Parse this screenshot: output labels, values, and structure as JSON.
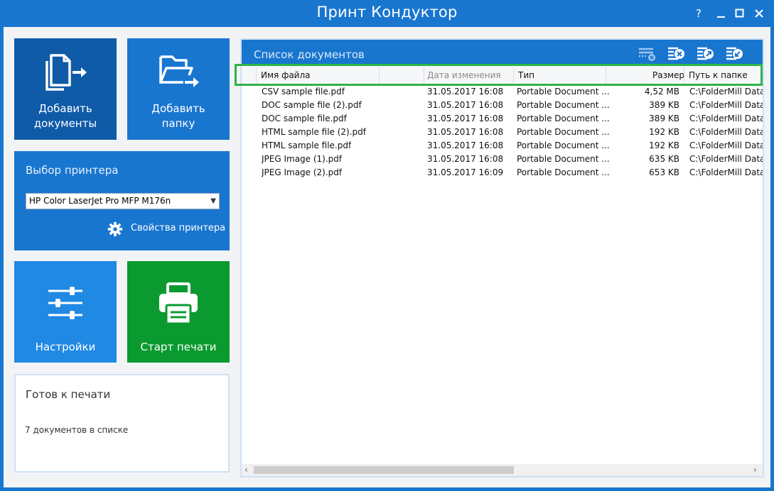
{
  "window": {
    "title": "Принт Кондуктор",
    "help_label": "?",
    "minimize_label": "—",
    "maximize_label": "☐",
    "close_label": "✕"
  },
  "tiles": {
    "add_documents": "Добавить\nдокументы",
    "add_folder": "Добавить\nпапку",
    "settings": "Настройки",
    "start_print": "Старт печати"
  },
  "printer": {
    "header": "Выбор принтера",
    "selected": "HP Color LaserJet Pro MFP M176n",
    "properties_label": "Свойства принтера"
  },
  "status": {
    "text": "Готов к печати",
    "count_text": "7 документов в списке"
  },
  "doclist": {
    "title": "Список документов",
    "columns": [
      "Имя файла",
      "Дата изменения",
      "Тип",
      "Размер",
      "Путь к папке"
    ],
    "rows": [
      {
        "name": "CSV sample file.pdf",
        "date": "31.05.2017 16:08",
        "type": "Portable Document ...",
        "size": "4,52 MB",
        "path": "C:\\FolderMill Data\\"
      },
      {
        "name": "DOC sample file (2).pdf",
        "date": "31.05.2017 16:08",
        "type": "Portable Document ...",
        "size": "389 KB",
        "path": "C:\\FolderMill Data\\"
      },
      {
        "name": "DOC sample file.pdf",
        "date": "31.05.2017 16:08",
        "type": "Portable Document ...",
        "size": "389 KB",
        "path": "C:\\FolderMill Data\\"
      },
      {
        "name": "HTML sample file (2).pdf",
        "date": "31.05.2017 16:08",
        "type": "Portable Document ...",
        "size": "192 KB",
        "path": "C:\\FolderMill Data\\"
      },
      {
        "name": "HTML sample file.pdf",
        "date": "31.05.2017 16:08",
        "type": "Portable Document ...",
        "size": "192 KB",
        "path": "C:\\FolderMill Data\\"
      },
      {
        "name": "JPEG Image (1).pdf",
        "date": "31.05.2017 16:08",
        "type": "Portable Document ...",
        "size": "635 KB",
        "path": "C:\\FolderMill Data\\"
      },
      {
        "name": "JPEG Image (2).pdf",
        "date": "31.05.2017 16:09",
        "type": "Portable Document ...",
        "size": "653 KB",
        "path": "C:\\FolderMill Data\\"
      }
    ]
  },
  "colors": {
    "accent_blue": "#1976cf",
    "dark_blue": "#0f5ba8",
    "bright_blue": "#2089e4",
    "green": "#0b9a2f",
    "highlight_green": "#2db34a"
  },
  "icons": [
    "add-documents-icon",
    "add-folder-icon",
    "settings-sliders-icon",
    "printer-icon",
    "gear-icon",
    "list-clear-icon",
    "list-remove-icon",
    "list-export-icon",
    "list-import-icon"
  ]
}
